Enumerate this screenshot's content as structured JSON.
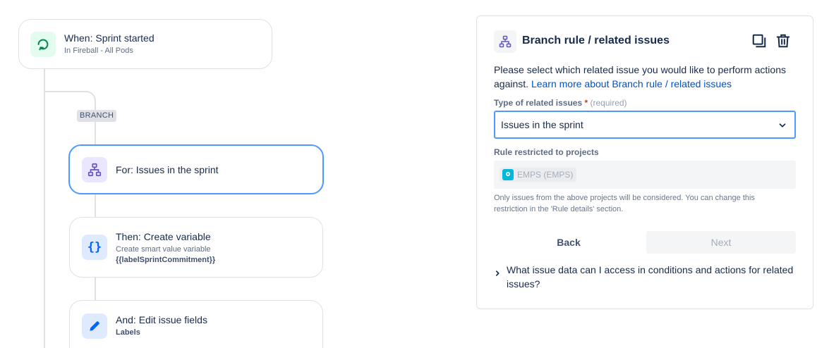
{
  "flow": {
    "trigger": {
      "title": "When: Sprint started",
      "subtitle": "In Fireball - All Pods"
    },
    "branch_tag": "BRANCH",
    "branch_node": {
      "title": "For: Issues in the sprint"
    },
    "create_variable": {
      "title": "Then: Create variable",
      "subtitle": "Create smart value variable",
      "detail": "{{labelSprintCommitment}}"
    },
    "edit_fields": {
      "title": "And: Edit issue fields",
      "detail": "Labels"
    }
  },
  "panel": {
    "title": "Branch rule / related issues",
    "description": "Please select which related issue you would like to perform actions against.",
    "learn_more": "Learn more about Branch rule / related issues",
    "type_label": "Type of related issues",
    "required_star": "*",
    "required_text": "(required)",
    "type_value": "Issues in the sprint",
    "projects_label": "Rule restricted to projects",
    "project_tag": "EMPS (EMPS)",
    "help_text": "Only issues from the above projects will be considered. You can change this restriction in the 'Rule details' section.",
    "back_label": "Back",
    "next_label": "Next",
    "faq": "What issue data can I access in conditions and actions for related issues?"
  },
  "icons": {
    "trigger": "refresh-cycle-icon",
    "branch": "hierarchy-icon",
    "variable": "curly-braces-icon",
    "edit": "pencil-icon",
    "duplicate": "duplicate-icon",
    "delete": "trash-icon",
    "dropdown": "chevron-down-icon",
    "faq": "chevron-right-icon"
  },
  "colors": {
    "selected_border": "#4c9aff",
    "link": "#0052cc",
    "trigger_icon_bg": "#e3fcef",
    "trigger_icon": "#00875a",
    "branch_icon_bg": "#eae6ff",
    "branch_icon": "#6554c0",
    "action_icon_bg": "#deebff",
    "action_icon": "#0065ff"
  }
}
